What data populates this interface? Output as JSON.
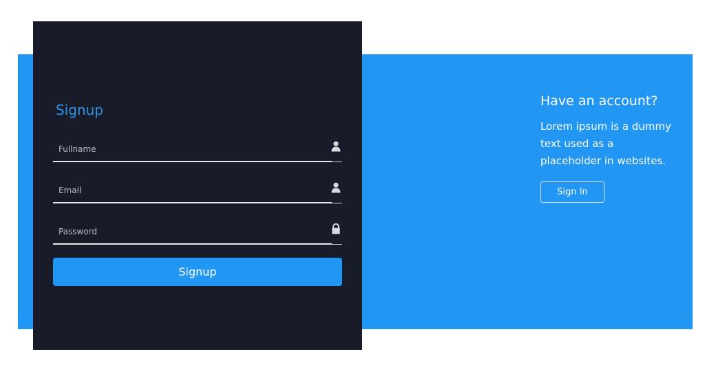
{
  "signup_form": {
    "title": "Signup",
    "fields": [
      {
        "placeholder": "Fullname",
        "value": "",
        "icon": "user-icon"
      },
      {
        "placeholder": "Email",
        "value": "",
        "icon": "user-icon"
      },
      {
        "placeholder": "Password",
        "value": "",
        "icon": "lock-icon"
      }
    ],
    "submit_label": "Signup"
  },
  "side_panel": {
    "title": "Have an account?",
    "text": "Lorem ipsum is a dummy text used as a placeholder in websites.",
    "signin_label": "Sign In"
  },
  "colors": {
    "accent_blue": "#2196f3",
    "card_dark": "#181c29",
    "title_blue": "#2d93e6",
    "text_white": "#ffffff"
  }
}
